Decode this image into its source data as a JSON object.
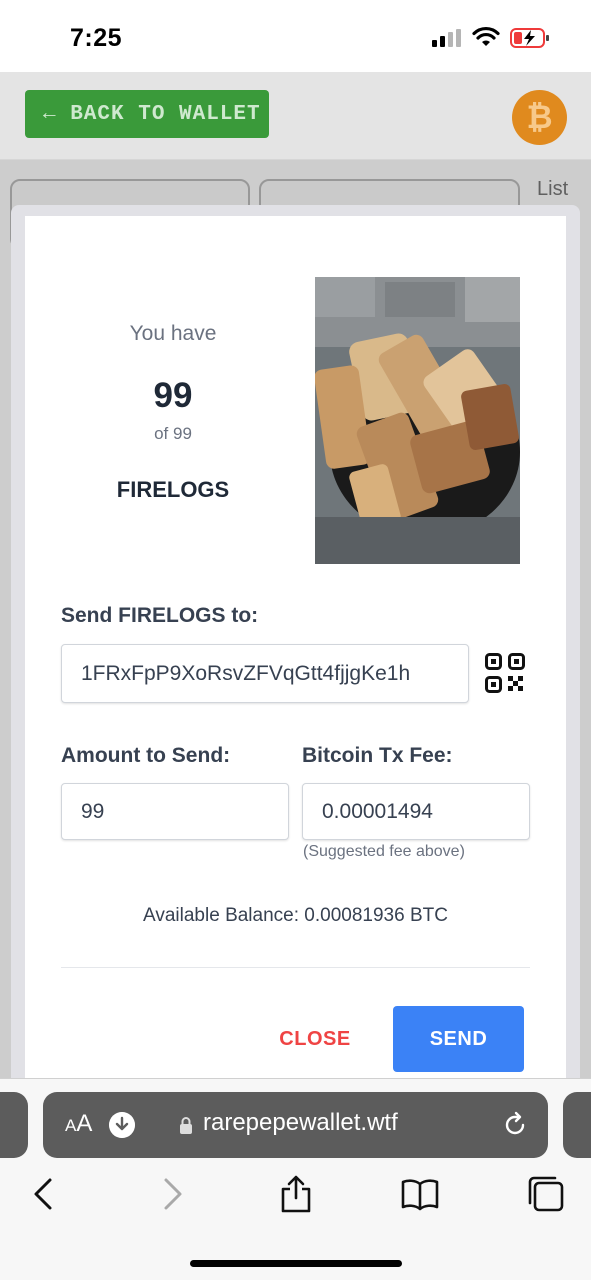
{
  "status_bar": {
    "time": "7:25"
  },
  "background_page": {
    "back_button_label": "← BACK TO WALLET",
    "coin_symbol": "₿",
    "list_label": "List"
  },
  "modal": {
    "you_have_label": "You have",
    "quantity": "99",
    "of_total": "of 99",
    "asset_name": "FIRELOGS",
    "send_to_label": "Send FIRELOGS to:",
    "address_value": "1FRxFpP9XoRsvZFVqGtt4fjjgKe1h",
    "amount_label": "Amount to Send:",
    "amount_value": "99",
    "fee_label": "Bitcoin Tx Fee:",
    "fee_value": "0.00001494",
    "fee_hint": "(Suggested fee above)",
    "available_balance": "Available Balance: 0.00081936 BTC",
    "close_label": "CLOSE",
    "send_label": "SEND"
  },
  "browser": {
    "aa_label_small": "A",
    "aa_label_large": "A",
    "url": "rarepepewallet.wtf"
  },
  "colors": {
    "send_button": "#3b82f6",
    "close_text": "#ef4444",
    "back_button": "#3a9a3a",
    "bitcoin_orange": "#e08a1e"
  }
}
